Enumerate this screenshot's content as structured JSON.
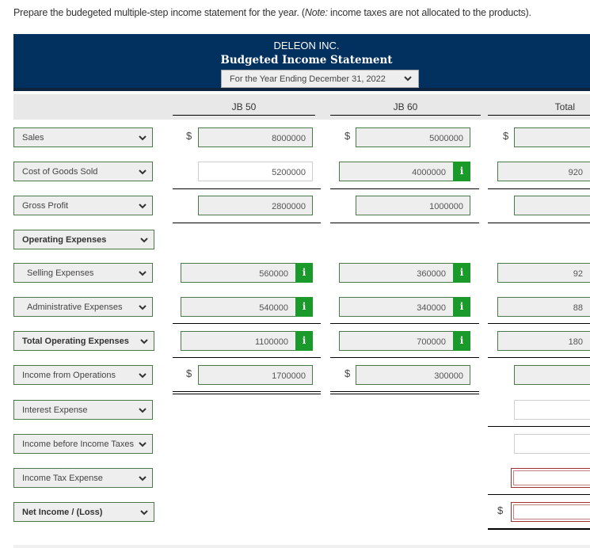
{
  "instruction": {
    "before_note": "Prepare the budegeted multiple-step income statement for the year. (",
    "note_label": "Note:",
    "after_note": " income taxes are not allocated to the products)."
  },
  "header": {
    "company": "DELEON INC.",
    "title": "Budgeted Income Statement",
    "period_select": "For the Year Ending December 31, 2022"
  },
  "columns": [
    "JB 50",
    "JB 60",
    "Total"
  ],
  "currency_symbol": "$",
  "colors": {
    "banner": "#02305f",
    "info_button": "#1a9a2a",
    "field_border": "#4a7a4a",
    "error_border": "#a03030"
  },
  "rows": [
    {
      "label": "Sales",
      "jb50": "8000000",
      "jb60": "5000000",
      "total": ""
    },
    {
      "label": "Cost of Goods Sold",
      "jb50": "5200000",
      "jb60": "4000000",
      "total": "920"
    },
    {
      "label": "Gross Profit",
      "jb50": "2800000",
      "jb60": "1000000",
      "total": ""
    },
    {
      "label": "Operating Expenses"
    },
    {
      "label": "Selling Expenses",
      "jb50": "560000",
      "jb60": "360000",
      "total": "92"
    },
    {
      "label": "Administrative Expenses",
      "jb50": "540000",
      "jb60": "340000",
      "total": "88"
    },
    {
      "label": "Total Operating Expenses",
      "jb50": "1100000",
      "jb60": "700000",
      "total": "180"
    },
    {
      "label": "Income from Operations",
      "jb50": "1700000",
      "jb60": "300000",
      "total": ""
    },
    {
      "label": "Interest Expense",
      "total": ""
    },
    {
      "label": "Income before Income Taxes",
      "total": ""
    },
    {
      "label": "Income Tax Expense",
      "total": ""
    },
    {
      "label": "Net Income / (Loss)",
      "total": ""
    }
  ],
  "info_icon": "i"
}
